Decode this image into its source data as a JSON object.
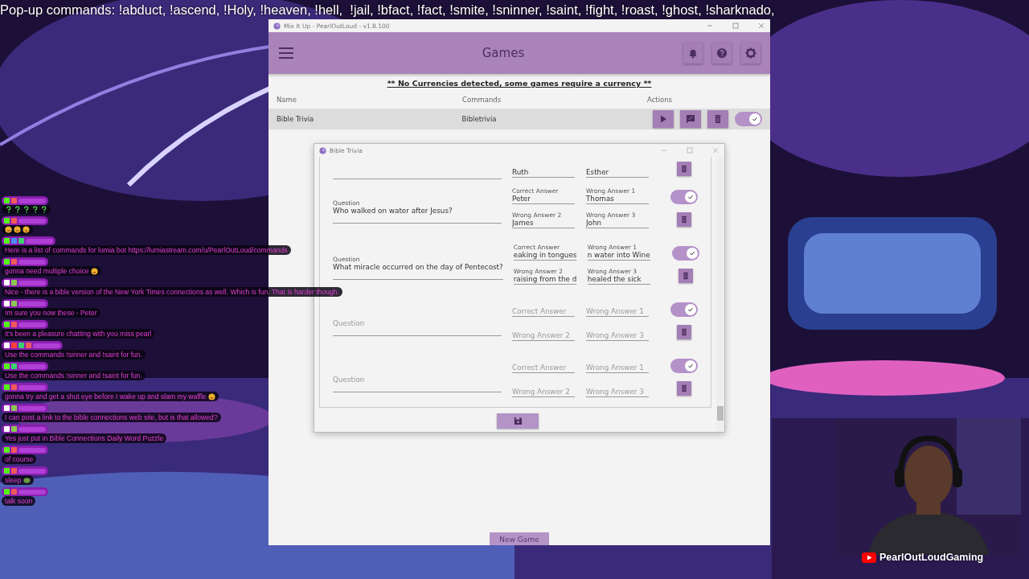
{
  "stream_ticker": "Pop-up commands: !abduct, !ascend, !Holy, !heaven, !hell,  !jail, !bfact, !fact, !smite, !sninner, !saint, !fight, !roast, !ghost, !sharknado,",
  "chat": {
    "messages": [
      {
        "badges": [
          {
            "kind": "kick"
          },
          {
            "kind": "crown"
          }
        ],
        "emojis": [
          {
            "kind": "question"
          },
          {
            "kind": "question"
          },
          {
            "kind": "question"
          },
          {
            "kind": "question"
          },
          {
            "kind": "question"
          }
        ]
      },
      {
        "badges": [
          {
            "kind": "kick"
          },
          {
            "kind": "crown"
          }
        ],
        "emojis": [
          {
            "kind": "face"
          },
          {
            "kind": "face"
          },
          {
            "kind": "face"
          }
        ]
      },
      {
        "badges": [
          {
            "kind": "kick"
          },
          {
            "kind": "person"
          },
          {
            "kind": "verified"
          }
        ],
        "text": "Here is a list of commands for lumia bot https://lumiastream.com/u/PearlOutLoud/commands"
      },
      {
        "badges": [
          {
            "kind": "kick"
          },
          {
            "kind": "crown"
          }
        ],
        "text": "gonna need multiple choice",
        "emojis": [
          {
            "kind": "face"
          }
        ]
      },
      {
        "badges": [
          {
            "kind": "chat"
          },
          {
            "kind": "leaf"
          }
        ],
        "text": "Nice - there is a bible version of the New York Times connections as well. Which is fun. That is harder though."
      },
      {
        "badges": [
          {
            "kind": "chat"
          },
          {
            "kind": "leaf"
          }
        ],
        "text": "Im sure you now these - Peter"
      },
      {
        "badges": [
          {
            "kind": "kick"
          },
          {
            "kind": "crown"
          }
        ],
        "text": "it's been a pleasure chatting with you miss pearl"
      },
      {
        "badges": [
          {
            "kind": "chat"
          },
          {
            "kind": "video"
          },
          {
            "kind": "verified"
          },
          {
            "kind": "crown"
          }
        ],
        "text": "Use the commands !sinner and !saint for fun."
      },
      {
        "badges": [
          {
            "kind": "kick"
          },
          {
            "kind": "verified"
          }
        ],
        "text": "Use the commands !sinner and !saint for fun."
      },
      {
        "badges": [
          {
            "kind": "kick"
          },
          {
            "kind": "crown"
          }
        ],
        "text": "gonna try and get a shut eye before I wake up and slam my waffle",
        "emojis": [
          {
            "kind": "face"
          }
        ]
      },
      {
        "badges": [
          {
            "kind": "chat"
          },
          {
            "kind": "leaf"
          }
        ],
        "text": "I can post a link to the bible connections web site, but is that allowed?"
      },
      {
        "badges": [
          {
            "kind": "chat"
          },
          {
            "kind": "leaf"
          }
        ],
        "text": "Yes just put in Bible Connections Daily Word Puzzle"
      },
      {
        "badges": [
          {
            "kind": "kick"
          },
          {
            "kind": "crown"
          }
        ],
        "text": "of course"
      },
      {
        "badges": [
          {
            "kind": "kick"
          },
          {
            "kind": "crown"
          }
        ],
        "text": "sleep",
        "emojis": [
          {
            "kind": "sticker"
          }
        ]
      },
      {
        "badges": [
          {
            "kind": "kick"
          },
          {
            "kind": "crown"
          }
        ],
        "text": "talk soon"
      }
    ]
  },
  "app": {
    "title": "Mix It Up - PearlOutLoud - v1.8.100",
    "page_title": "Games",
    "notice": "** No Currencies detected, some games require a currency **",
    "columns": [
      "Name",
      "Commands",
      "Actions"
    ],
    "rows": [
      {
        "name": "Bible Trivia",
        "commands": "Bibletrivia",
        "enabled": true
      }
    ],
    "new_game_button": "New Game"
  },
  "dialog": {
    "title": "Bible Trivia",
    "entries": [
      {
        "row_2": {
          "answers": [
            {
              "value": "Ruth"
            },
            {
              "value": "Esther"
            }
          ]
        }
      },
      {
        "question": {
          "label": "Question",
          "value": "Who walked on water after Jesus?"
        },
        "row_1": {
          "answers": [
            {
              "label": "Correct Answer",
              "value": "Peter"
            },
            {
              "label": "Wrong Answer 1",
              "value": "Thomas"
            }
          ],
          "enabled": true
        },
        "row_2": {
          "answers": [
            {
              "label": "Wrong Answer 2",
              "value": "James"
            },
            {
              "label": "Wrong Answer 3",
              "value": "John"
            }
          ]
        }
      },
      {
        "question": {
          "label": "Question",
          "value": "What miracle occurred on the day of Pentecost?"
        },
        "row_1": {
          "answers": [
            {
              "label": "Correct Answer",
              "value": "eaking in tongues"
            },
            {
              "label": "Wrong Answer 1",
              "value": "n water into Wine"
            }
          ],
          "enabled": true
        },
        "row_2": {
          "answers": [
            {
              "label": "Wrong Answer 2",
              "value": "raising from the d"
            },
            {
              "label": "Wrong Answer 3",
              "value": "healed the sick"
            }
          ]
        }
      },
      {
        "question": {
          "placeholder": "Question"
        },
        "row_1": {
          "answers": [
            {
              "placeholder": "Correct Answer"
            },
            {
              "placeholder": "Wrong Answer 1"
            }
          ],
          "enabled": true
        },
        "row_2": {
          "answers": [
            {
              "placeholder": "Wrong Answer 2"
            },
            {
              "placeholder": "Wrong Answer 3"
            }
          ]
        }
      },
      {
        "question": {
          "placeholder": "Question"
        },
        "row_1": {
          "answers": [
            {
              "placeholder": "Correct Answer"
            },
            {
              "placeholder": "Wrong Answer 1"
            }
          ],
          "enabled": true
        },
        "row_2": {
          "answers": [
            {
              "placeholder": "Wrong Answer 2"
            },
            {
              "placeholder": "Wrong Answer 3"
            }
          ]
        }
      }
    ]
  },
  "webcam": {
    "kind": "picture",
    "channel": "PearlOutLoudGaming"
  }
}
